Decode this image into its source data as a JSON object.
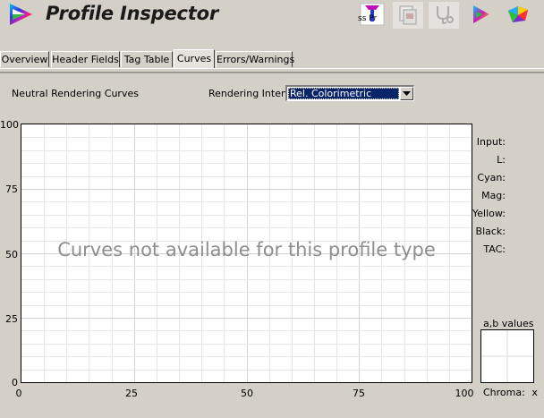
{
  "app": {
    "title": "Profile Inspector"
  },
  "toolbar": {
    "buttons": [
      {
        "icon": "profile-text-icon",
        "caption": "ss Pr",
        "enabled": true
      },
      {
        "icon": "copy-document-icon",
        "enabled": false
      },
      {
        "icon": "stethoscope-icon",
        "enabled": false
      },
      {
        "icon": "gamut-view-icon",
        "enabled": true
      },
      {
        "icon": "3d-gamut-icon",
        "enabled": true
      }
    ]
  },
  "tabs": [
    {
      "label": "Overview",
      "active": false
    },
    {
      "label": "Header Fields",
      "active": false
    },
    {
      "label": "Tag Table",
      "active": false
    },
    {
      "label": "Curves",
      "active": true
    },
    {
      "label": "Errors/Warnings",
      "active": false
    }
  ],
  "curves": {
    "heading": "Neutral Rendering Curves",
    "intent_label": "Rendering Intent:",
    "intent_value": "Rel. Colorimetric",
    "message": "Curves not available for this profile type"
  },
  "chart_data": {
    "type": "line",
    "title": "",
    "xlabel": "",
    "ylabel": "",
    "xlim": [
      0,
      100
    ],
    "ylim": [
      0,
      100
    ],
    "x_ticks": [
      "0",
      "25",
      "50",
      "75",
      "100"
    ],
    "y_ticks": [
      "100",
      "75",
      "50",
      "25",
      "0"
    ],
    "grid": true,
    "series": []
  },
  "readouts": {
    "labels": [
      "Input:",
      "L:",
      "Cyan:",
      "Mag:",
      "Yellow:",
      "Black:",
      "TAC:"
    ],
    "ab_label": "a,b values",
    "chroma_label": "Chroma:",
    "chroma_value": "x"
  }
}
